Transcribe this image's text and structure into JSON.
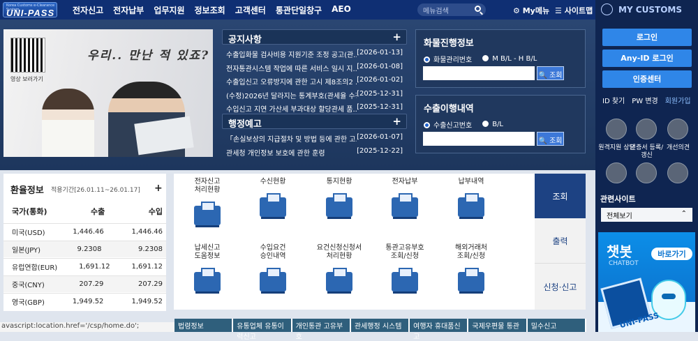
{
  "header": {
    "logo": "UNI-PASS",
    "logo_sub": "Korea Customs e-Clearance System",
    "menu": [
      "전자신고",
      "전자납부",
      "업무지원",
      "정보조회",
      "고객센터",
      "통관단일창구",
      "AEO"
    ],
    "search_placeholder": "메뉴검색",
    "mymenu": "My메뉴",
    "sitemap": "사이트맵"
  },
  "banner": {
    "qr_label": "영상 보러가기",
    "slogan": "우리.. 만난 적 있죠?",
    "prev": "|",
    "pause": "||",
    "next": ">"
  },
  "notice": {
    "title": "공지사항",
    "items": [
      {
        "text": "수출입화물 검사비용 지원기준 조정 공고(관...",
        "date": "[2026-01-13]"
      },
      {
        "text": "전자통관시스템 작업에 따른 서비스 일시 지...",
        "date": "[2026-01-08]"
      },
      {
        "text": "수출입신고 오류방지에 관한 고시 제8조의2 ...",
        "date": "[2026-01-02]"
      },
      {
        "text": "(수정)2026년 달라지는 통계부호(관세율 수정)",
        "date": "[2025-12-31]"
      },
      {
        "text": "수입신고 지연 가산세 부과대상 할당관세 품...",
        "date": "[2025-12-31]"
      }
    ]
  },
  "admin": {
    "title": "행정예고",
    "items": [
      {
        "text": "「손실보상의 지급절차 및 방법 등에 관한 고...",
        "date": "[2026-01-07]"
      },
      {
        "text": "관세청 개인정보 보호에 관한 훈령",
        "date": "[2025-12-22]"
      }
    ]
  },
  "cargo": {
    "title": "화물진행정보",
    "opt1": "화물관리번호",
    "opt2": "M B/L - H B/L",
    "button": "조회"
  },
  "export": {
    "title": "수출이행내역",
    "opt1": "수출신고번호",
    "opt2": "B/L",
    "button": "조회"
  },
  "exchange": {
    "title": "환율정보",
    "period": "적용기간[26.01.11~26.01.17]",
    "col1": "국가(통화)",
    "col2": "수출",
    "col3": "수입",
    "rows": [
      [
        "미국(USD)",
        "1,446.46",
        "1,446.46"
      ],
      [
        "일본(JPY)",
        "9.2308",
        "9.2308"
      ],
      [
        "유럽연합(EUR)",
        "1,691.12",
        "1,691.12"
      ],
      [
        "중국(CNY)",
        "207.29",
        "207.29"
      ],
      [
        "영국(GBP)",
        "1,949.52",
        "1,949.52"
      ]
    ]
  },
  "services": [
    [
      "전자신고",
      "처리현황"
    ],
    [
      "수신현황"
    ],
    [
      "통지현황"
    ],
    [
      "전자납부"
    ],
    [
      "납부내역"
    ],
    [
      "납세신고",
      "도움정보"
    ],
    [
      "수입요건",
      "승인내역"
    ],
    [
      "요건신청신청서",
      "처리현황"
    ],
    [
      "통관고유부호",
      "조회/신청"
    ],
    [
      "해외거래처",
      "조회/신청"
    ]
  ],
  "tabs": [
    "조회",
    "출력",
    "신청·신고"
  ],
  "status_url": "avascript:location.href='/csp/home.do';",
  "bottom": [
    "법령정보",
    "유통업체 유통이력신고",
    "개인통관 고유부호",
    "관세행정 시스템",
    "여행자 휴대품신고",
    "국제우편물 통관",
    "밀수신고"
  ],
  "right": {
    "title": "MY CUSTOMS",
    "login": "로그인",
    "anyid": "Any-ID 로그인",
    "cert": "인증센터",
    "links": [
      "ID 찾기",
      "PW 변경",
      "회원가입"
    ],
    "icons": [
      "원격지원 상담",
      "인증서 등록/갱신",
      "개선의견",
      "",
      "",
      ""
    ],
    "related": "관련사이트",
    "select": "전체보기",
    "chatbot": "챗봇",
    "chatbot_en": "CHATBOT",
    "go": "바로가기",
    "unipass": "UNI-PASS"
  },
  "colors": {
    "navy": "#0f2f73",
    "blue": "#1d4283",
    "button": "#2f86e8"
  }
}
